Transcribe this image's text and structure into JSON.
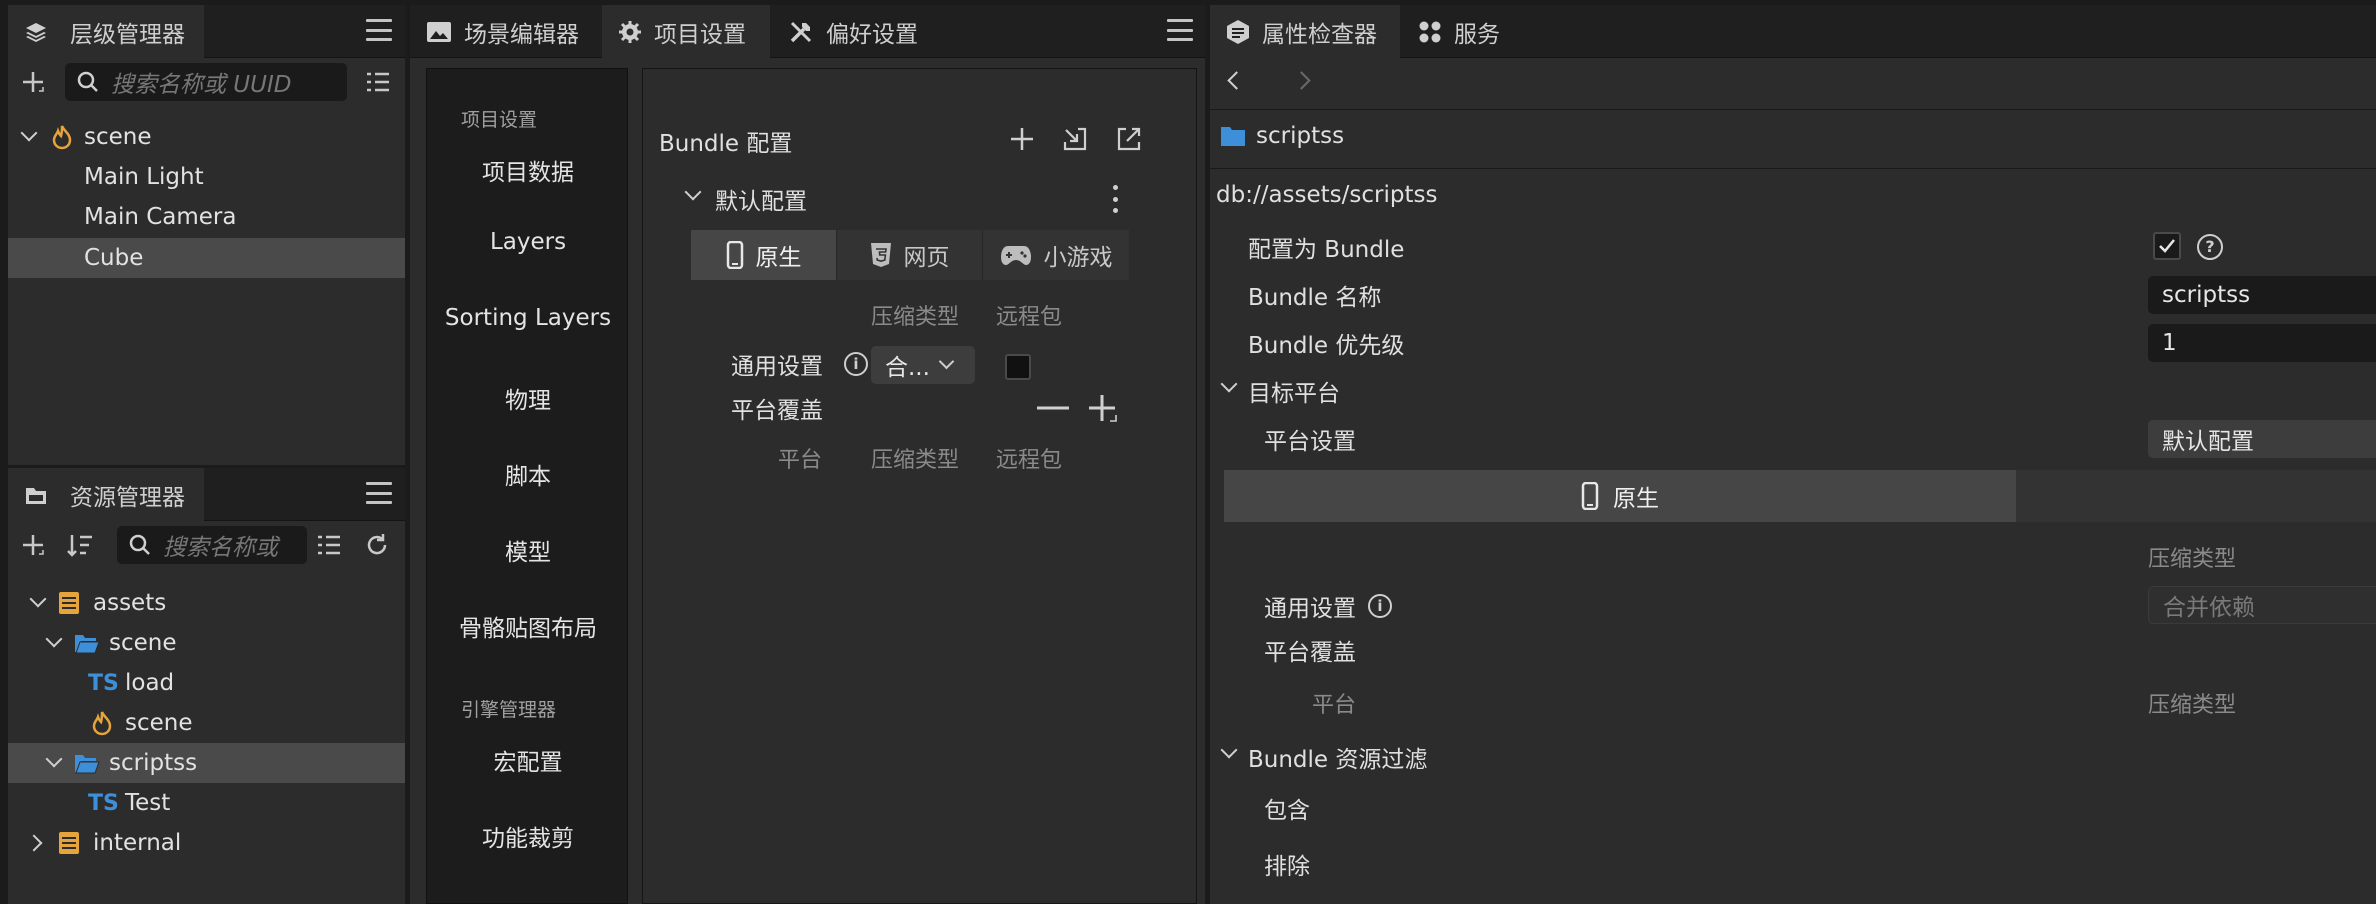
{
  "hierarchy": {
    "title": "层级管理器",
    "search_placeholder": "搜索名称或 UUID",
    "nodes": [
      {
        "label": "scene"
      },
      {
        "label": "Main Light"
      },
      {
        "label": "Main Camera"
      },
      {
        "label": "Cube"
      }
    ]
  },
  "assets": {
    "title": "资源管理器",
    "search_placeholder": "搜索名称或",
    "nodes": [
      {
        "label": "assets"
      },
      {
        "label": "scene"
      },
      {
        "label": "load",
        "badge": "TS"
      },
      {
        "label": "scene"
      },
      {
        "label": "scriptss"
      },
      {
        "label": "Test",
        "badge": "TS"
      },
      {
        "label": "internal"
      }
    ]
  },
  "center": {
    "tabs": [
      {
        "label": "场景编辑器",
        "icon": "scene-editor-icon"
      },
      {
        "label": "项目设置",
        "icon": "gear-icon"
      },
      {
        "label": "偏好设置",
        "icon": "tools-icon"
      }
    ],
    "nav": {
      "group1": "项目设置",
      "items1": [
        "项目数据",
        "Layers",
        "Sorting Layers",
        "物理",
        "脚本",
        "模型",
        "骨骼贴图布局"
      ],
      "group2": "引擎管理器",
      "items2": [
        "宏配置",
        "功能裁剪"
      ]
    },
    "bundle": {
      "title": "Bundle 配置",
      "preset": "默认配置",
      "platform_tabs": [
        "原生",
        "网页",
        "小游戏"
      ],
      "col_compress": "压缩类型",
      "col_remote": "远程包",
      "general_label": "通用设置",
      "general_value": "合...",
      "override_label": "平台覆盖",
      "col_platform": "平台"
    }
  },
  "inspector": {
    "tabs": [
      {
        "label": "属性检查器",
        "icon": "inspector-icon"
      },
      {
        "label": "服务",
        "icon": "services-icon"
      }
    ],
    "asset_name": "scriptss",
    "path": "db://assets/scriptss",
    "is_bundle_label": "配置为 Bundle",
    "is_bundle_checked": true,
    "bundle_name_label": "Bundle 名称",
    "bundle_name_value": "scriptss",
    "bundle_priority_label": "Bundle 优先级",
    "bundle_priority_value": "1",
    "target_platform_label": "目标平台",
    "platform_settings_label": "平台设置",
    "platform_settings_value": "默认配置",
    "platform_tab": "原生",
    "col_compress": "压缩类型",
    "general_label": "通用设置",
    "general_value": "合并依赖",
    "override_label": "平台覆盖",
    "col_platform": "平台",
    "col_compress2": "压缩类型",
    "filter_label": "Bundle 资源过滤",
    "include_label": "包含",
    "exclude_label": "排除"
  }
}
